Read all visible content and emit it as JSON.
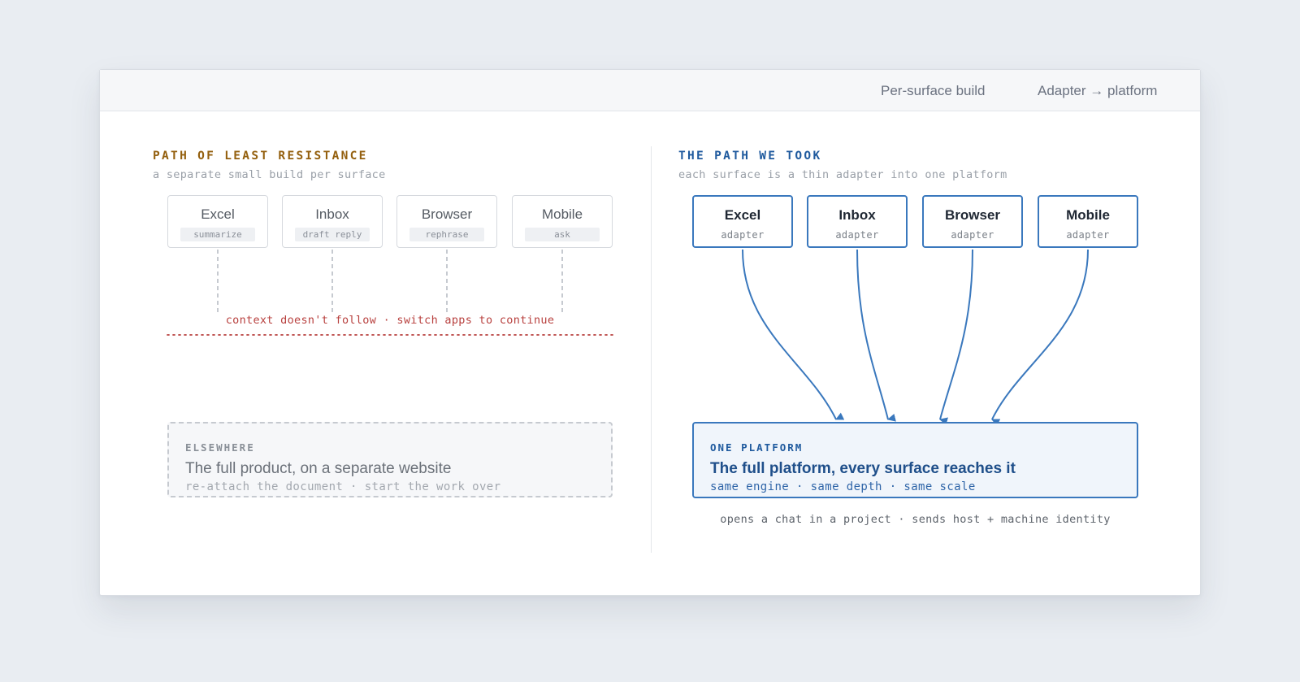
{
  "legend": {
    "dashed_label": "Per-surface build",
    "solid_label": "Adapter → platform"
  },
  "left": {
    "heading": "PATH OF LEAST RESISTANCE",
    "subheading": "a separate small build per surface",
    "surfaces": [
      {
        "name": "Excel",
        "action": "summarize"
      },
      {
        "name": "Inbox",
        "action": "draft reply"
      },
      {
        "name": "Browser",
        "action": "rephrase"
      },
      {
        "name": "Mobile",
        "action": "ask"
      }
    ],
    "break_note": "context doesn't follow · switch apps to continue",
    "elsewhere": {
      "label": "ELSEWHERE",
      "title": "The full product, on a separate website",
      "subtitle": "re-attach the document · start the work over"
    }
  },
  "right": {
    "heading": "THE PATH WE TOOK",
    "subheading": "each surface is a thin adapter into one platform",
    "surfaces": [
      {
        "name": "Excel",
        "role": "adapter"
      },
      {
        "name": "Inbox",
        "role": "adapter"
      },
      {
        "name": "Browser",
        "role": "adapter"
      },
      {
        "name": "Mobile",
        "role": "adapter"
      }
    ],
    "platform": {
      "label": "ONE PLATFORM",
      "title": "The full platform, every surface reaches it",
      "subtitle": "same engine · same depth · same scale"
    },
    "footnote": "opens a chat in a project · sends host + machine identity"
  },
  "colors": {
    "left_heading": "#94600f",
    "right_heading": "#1f5a9e",
    "adapter_blue": "#3a78bd",
    "break_red": "#b8403e",
    "dashed_gray": "#b4b9c0"
  }
}
